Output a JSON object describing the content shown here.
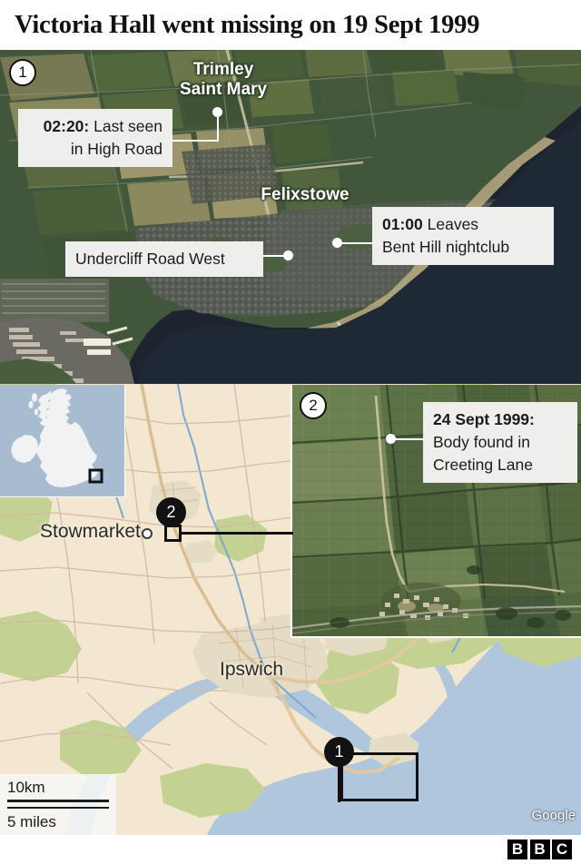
{
  "title": "Victoria Hall went missing on 19 Sept 1999",
  "panels": {
    "panel1_badge": "1",
    "panel2_badge": "2",
    "locator_badge_1": "1",
    "locator_badge_2": "2"
  },
  "callouts": [
    {
      "id": "high-road",
      "time": "02:20:",
      "text": "Last seen in High Road",
      "line1_bold": "02:20:",
      "line1_rest": " Last seen",
      "line2": "in High Road"
    },
    {
      "id": "undercliff",
      "time": "",
      "text": "Undercliff Road West",
      "line1_bold": "",
      "line1_rest": "Undercliff Road West",
      "line2": ""
    },
    {
      "id": "bent-hill",
      "time": "01:00",
      "text": "Leaves Bent Hill nightclub",
      "line1_bold": "01:00",
      "line1_rest": " Leaves",
      "line2": "Bent Hill nightclub"
    },
    {
      "id": "creeting",
      "time": "24 Sept 1999:",
      "text": "Body found in Creeting Lane",
      "line1_bold": "24 Sept 1999:",
      "line1_rest": "",
      "line2": "Body found in",
      "line3": "Creeting Lane"
    }
  ],
  "map_labels": {
    "trimley_line1": "Trimley",
    "trimley_line2": "Saint Mary",
    "felixstowe": "Felixstowe",
    "stowmarket": "Stowmarket",
    "ipswich": "Ipswich"
  },
  "scale": {
    "km": "10km",
    "miles": "5 miles"
  },
  "attribution": {
    "provider": "Google"
  },
  "brand": {
    "b1": "B",
    "b2": "B",
    "b3": "C"
  },
  "colors": {
    "water_dark": "#1d2430",
    "water_light": "#aec7dc",
    "land_tan": "#f2e6cf",
    "land_green": "#c3d293",
    "callout_bg": "#eeeeec",
    "badge_dark": "#111111"
  }
}
